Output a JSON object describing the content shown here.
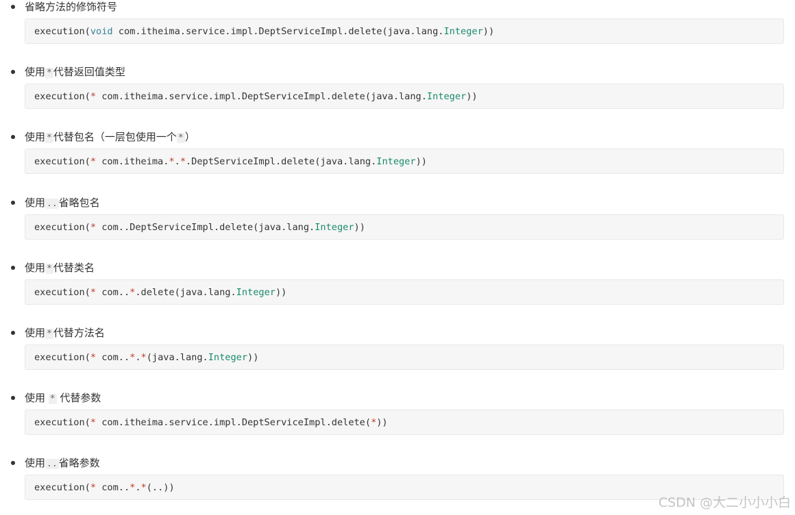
{
  "items": [
    {
      "label": [
        {
          "t": "省略方法的修饰符号",
          "k": "text"
        }
      ],
      "code": [
        {
          "t": "execution(",
          "k": "plain"
        },
        {
          "t": "void",
          "k": "kw"
        },
        {
          "t": " com.itheima.service.impl.DeptServiceImpl.delete(java.lang.",
          "k": "plain"
        },
        {
          "t": "Integer",
          "k": "type"
        },
        {
          "t": "))",
          "k": "plain"
        }
      ]
    },
    {
      "label": [
        {
          "t": "使用",
          "k": "text"
        },
        {
          "t": "*",
          "k": "code"
        },
        {
          "t": "代替返回值类型",
          "k": "text"
        }
      ],
      "code": [
        {
          "t": "execution(",
          "k": "plain"
        },
        {
          "t": "*",
          "k": "op"
        },
        {
          "t": " com.itheima.service.impl.DeptServiceImpl.delete(java.lang.",
          "k": "plain"
        },
        {
          "t": "Integer",
          "k": "type"
        },
        {
          "t": "))",
          "k": "plain"
        }
      ]
    },
    {
      "label": [
        {
          "t": "使用",
          "k": "text"
        },
        {
          "t": "*",
          "k": "code"
        },
        {
          "t": "代替包名（一层包使用一个",
          "k": "text"
        },
        {
          "t": "*",
          "k": "code"
        },
        {
          "t": "）",
          "k": "text"
        }
      ],
      "code": [
        {
          "t": "execution(",
          "k": "plain"
        },
        {
          "t": "*",
          "k": "op"
        },
        {
          "t": " com.itheima.",
          "k": "plain"
        },
        {
          "t": "*",
          "k": "op"
        },
        {
          "t": ".",
          "k": "plain"
        },
        {
          "t": "*",
          "k": "op"
        },
        {
          "t": ".DeptServiceImpl.delete(java.lang.",
          "k": "plain"
        },
        {
          "t": "Integer",
          "k": "type"
        },
        {
          "t": "))",
          "k": "plain"
        }
      ]
    },
    {
      "label": [
        {
          "t": "使用",
          "k": "text"
        },
        {
          "t": "..",
          "k": "code"
        },
        {
          "t": "省略包名",
          "k": "text"
        }
      ],
      "code": [
        {
          "t": "execution(",
          "k": "plain"
        },
        {
          "t": "*",
          "k": "op"
        },
        {
          "t": " com..DeptServiceImpl.delete(java.lang.",
          "k": "plain"
        },
        {
          "t": "Integer",
          "k": "type"
        },
        {
          "t": "))",
          "k": "plain"
        }
      ]
    },
    {
      "label": [
        {
          "t": "使用",
          "k": "text"
        },
        {
          "t": "*",
          "k": "code"
        },
        {
          "t": "代替类名",
          "k": "text"
        }
      ],
      "code": [
        {
          "t": "execution(",
          "k": "plain"
        },
        {
          "t": "*",
          "k": "op"
        },
        {
          "t": " com..",
          "k": "plain"
        },
        {
          "t": "*",
          "k": "op"
        },
        {
          "t": ".delete(java.lang.",
          "k": "plain"
        },
        {
          "t": "Integer",
          "k": "type"
        },
        {
          "t": "))",
          "k": "plain"
        }
      ]
    },
    {
      "label": [
        {
          "t": "使用",
          "k": "text"
        },
        {
          "t": "*",
          "k": "code"
        },
        {
          "t": "代替方法名",
          "k": "text"
        }
      ],
      "code": [
        {
          "t": "execution(",
          "k": "plain"
        },
        {
          "t": "*",
          "k": "op"
        },
        {
          "t": " com..",
          "k": "plain"
        },
        {
          "t": "*",
          "k": "op"
        },
        {
          "t": ".",
          "k": "plain"
        },
        {
          "t": "*",
          "k": "op"
        },
        {
          "t": "(java.lang.",
          "k": "plain"
        },
        {
          "t": "Integer",
          "k": "type"
        },
        {
          "t": "))",
          "k": "plain"
        }
      ]
    },
    {
      "label": [
        {
          "t": "使用 ",
          "k": "text"
        },
        {
          "t": "*",
          "k": "code"
        },
        {
          "t": " 代替参数",
          "k": "text"
        }
      ],
      "code": [
        {
          "t": "execution(",
          "k": "plain"
        },
        {
          "t": "*",
          "k": "op"
        },
        {
          "t": " com.itheima.service.impl.DeptServiceImpl.delete(",
          "k": "plain"
        },
        {
          "t": "*",
          "k": "op"
        },
        {
          "t": "))",
          "k": "plain"
        }
      ]
    },
    {
      "label": [
        {
          "t": "使用",
          "k": "text"
        },
        {
          "t": "..",
          "k": "code"
        },
        {
          "t": "省略参数",
          "k": "text"
        }
      ],
      "code": [
        {
          "t": "execution(",
          "k": "plain"
        },
        {
          "t": "*",
          "k": "op"
        },
        {
          "t": " com..",
          "k": "plain"
        },
        {
          "t": "*",
          "k": "op"
        },
        {
          "t": ".",
          "k": "plain"
        },
        {
          "t": "*",
          "k": "op"
        },
        {
          "t": "(..))",
          "k": "plain"
        }
      ]
    }
  ],
  "watermark": "CSDN @大二小小小白"
}
